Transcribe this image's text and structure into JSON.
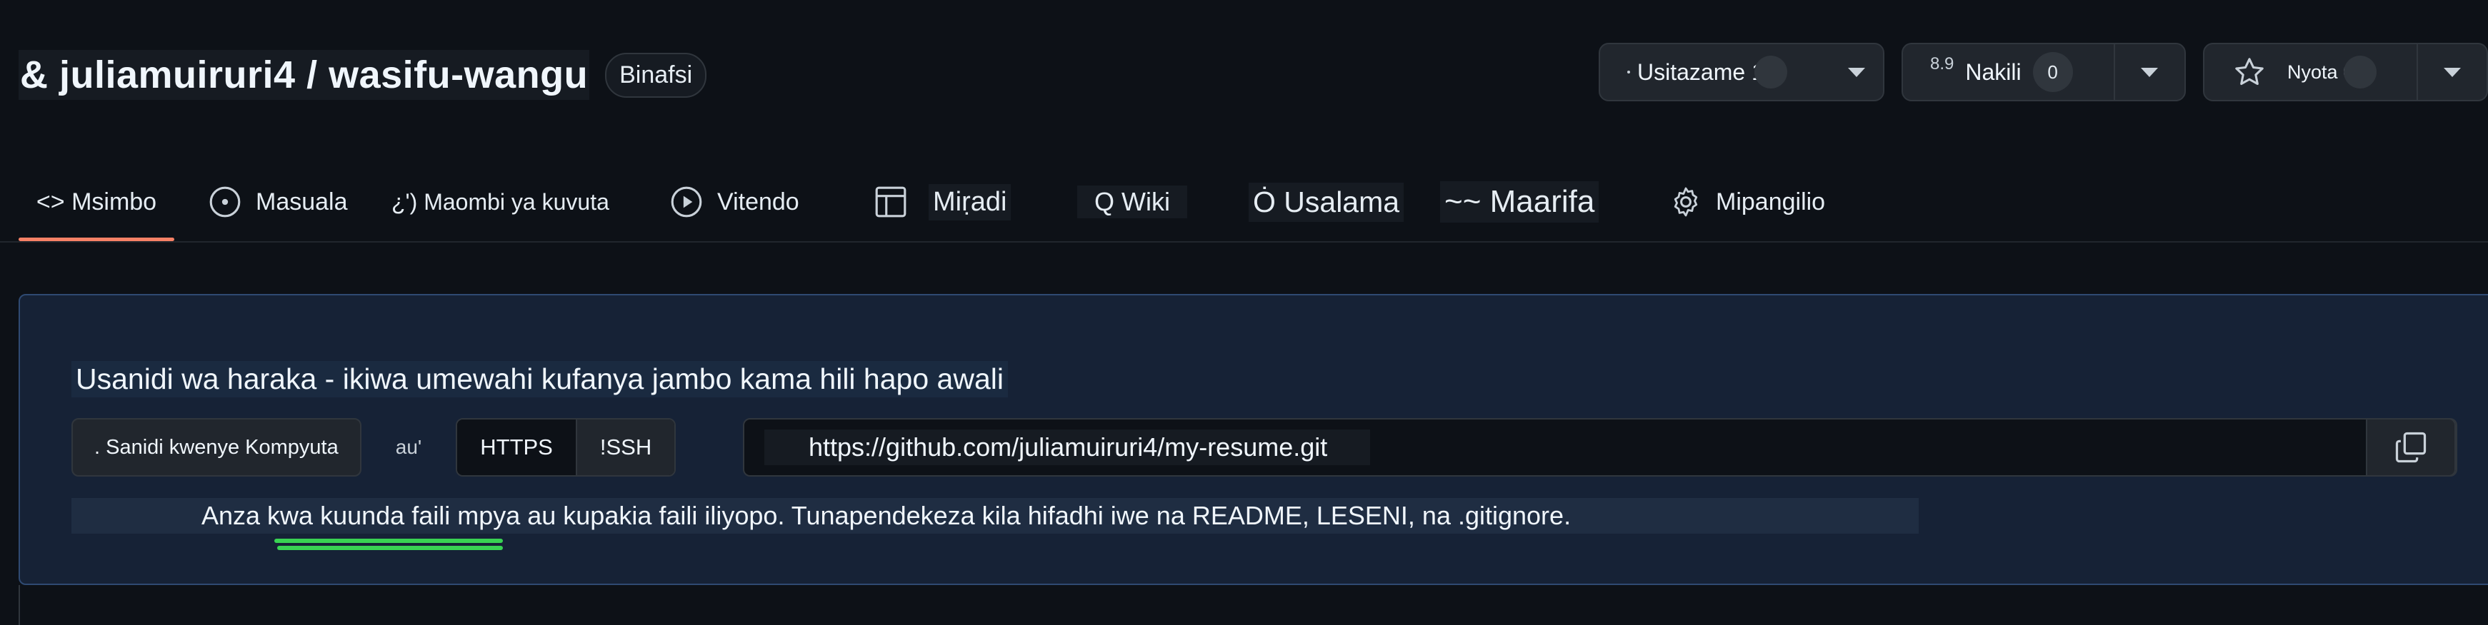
{
  "repo": {
    "path": "& juliamuiruri4 / wasifu-wangu",
    "visibility": "Binafsi"
  },
  "actions": {
    "watch": {
      "label": "Usitazame 1"
    },
    "fork": {
      "label": "Nakili",
      "count": "0",
      "badge": "8.9"
    },
    "star": {
      "label": "Nyota 0"
    }
  },
  "tabs": [
    {
      "label": "<> Msimbo",
      "icon": "code-icon",
      "active": true
    },
    {
      "label": "Masuala",
      "icon": "issue-icon"
    },
    {
      "label": "¿') Maombi ya kuvuta",
      "icon": "pull-request-icon"
    },
    {
      "label": "Vitendo",
      "icon": "play-icon"
    },
    {
      "label": "Miṛadi",
      "icon": "table-icon"
    },
    {
      "label": "Q Wiki",
      "icon": "wiki-icon"
    },
    {
      "label": "Ȯ Usalama",
      "icon": "shield-icon"
    },
    {
      "label": "~~ Maarifa",
      "icon": "graph-icon"
    },
    {
      "label": "Mipangilio",
      "icon": "gear-icon"
    }
  ],
  "setup": {
    "title": "Usanidi wa haraka - ikiwa umewahi kufanya jambo kama hili hapo awali",
    "desktop_button": ". Sanidi kwenye Kompyuta",
    "or_text": "au'",
    "protocols": [
      "HTTPS",
      "!SSH"
    ],
    "url": "https://github.com/juliamuiruri4/my-resume.git",
    "hint": "Anza kwa kuunda faili mpya au kupakia faili iliyopo. Tunapendekeza kila hifadhi iwe na README, LESENI, na .gitignore."
  },
  "colors": {
    "background": "#0d1117",
    "active_tab_underline": "#f78166",
    "panel": "#162236",
    "highlight_mark": "#39d353"
  }
}
